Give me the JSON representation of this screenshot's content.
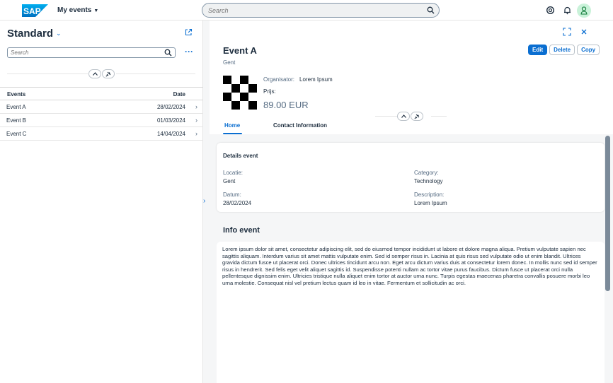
{
  "shell": {
    "logo_text": "SAP",
    "app_title": "My events",
    "search_placeholder": "Search",
    "icons": [
      "copilot-icon",
      "bell-icon",
      "user-avatar-icon"
    ]
  },
  "list": {
    "variant": "Standard",
    "search_placeholder": "Search",
    "columns": {
      "events": "Events",
      "date": "Date"
    },
    "rows": [
      {
        "name": "Event A",
        "date": "28/02/2024"
      },
      {
        "name": "Event B",
        "date": "01/03/2024"
      },
      {
        "name": "Event C",
        "date": "14/04/2024"
      }
    ]
  },
  "detail": {
    "title": "Event A",
    "subtitle": "Gent",
    "actions": {
      "edit": "Edit",
      "delete": "Delete",
      "copy": "Copy"
    },
    "organisator_label": "Organisator:",
    "organisator_value": "Lorem Ipsum",
    "prijs_label": "Prijs:",
    "prijs_value": "89.00 EUR",
    "tabs": {
      "home": "Home",
      "contact": "Contact Information"
    },
    "details_title": "Details event",
    "fields": {
      "locatie_label": "Locatie:",
      "locatie_value": "Gent",
      "datum_label": "Datum:",
      "datum_value": "28/02/2024",
      "category_label": "Category:",
      "category_value": "Technology",
      "description_label": "Description:",
      "description_value": "Lorem Ipsum"
    },
    "info_title": "Info event",
    "info_text": "Lorem ipsum dolor sit amet, consectetur adipiscing elit, sed do eiusmod tempor incididunt ut labore et dolore magna aliqua. Pretium vulputate sapien nec sagittis aliquam. Interdum varius sit amet mattis vulputate enim. Sed id semper risus in. Lacinia at quis risus sed vulputate odio ut enim blandit. Ultrices gravida dictum fusce ut placerat orci. Donec ultrices tincidunt arcu non. Eget arcu dictum varius duis at consectetur lorem donec. In mollis nunc sed id semper risus in hendrerit. Sed felis eget velit aliquet sagittis id. Suspendisse potenti nullam ac tortor vitae purus faucibus. Dictum fusce ut placerat orci nulla pellentesque dignissim enim. Ultricies tristique nulla aliquet enim tortor at auctor urna nunc. Turpis egestas maecenas pharetra convallis posuere morbi leo urna molestie. Consequat nisl vel pretium lectus quam id leo in vitae. Fermentum et sollicitudin ac orci."
  },
  "colors": {
    "accent": "#0a6ed1",
    "text": "#1d2d3e",
    "muted": "#556b82",
    "background": "#f5f6f7"
  }
}
